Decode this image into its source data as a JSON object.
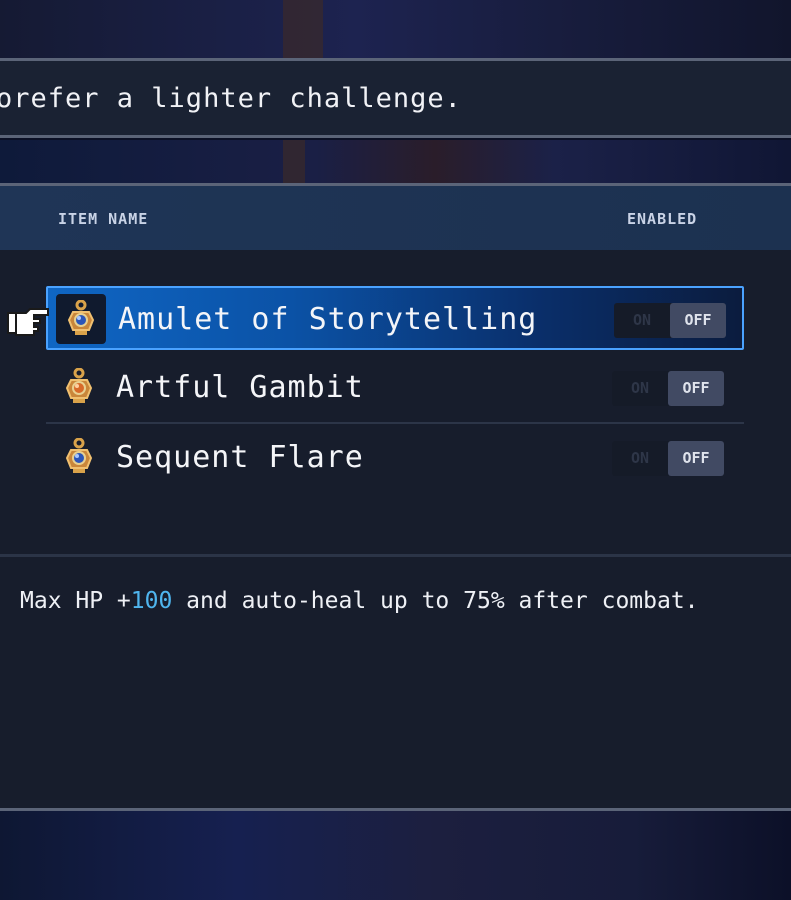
{
  "dialogue": {
    "text": "orefer a lighter challenge."
  },
  "table": {
    "headers": {
      "name": "ITEM NAME",
      "enabled": "ENABLED"
    },
    "rows": [
      {
        "label": "Amulet of Storytelling",
        "on": "ON",
        "off": "OFF",
        "selected": true,
        "state": "off",
        "icon": "amulet-icon"
      },
      {
        "label": "Artful Gambit",
        "on": "ON",
        "off": "OFF",
        "selected": false,
        "state": "off",
        "icon": "amulet-icon"
      },
      {
        "label": "Sequent Flare",
        "on": "ON",
        "off": "OFF",
        "selected": false,
        "state": "off",
        "icon": "amulet-icon"
      }
    ]
  },
  "description": {
    "prefix": "Max HP +",
    "highlight": "100",
    "suffix": " and auto-heal up to 75% after combat."
  },
  "colors": {
    "selection": "#0f66c4",
    "selection_border": "#4aa2ff",
    "highlight_text": "#4fb5ee",
    "panel": "#171d2c"
  }
}
